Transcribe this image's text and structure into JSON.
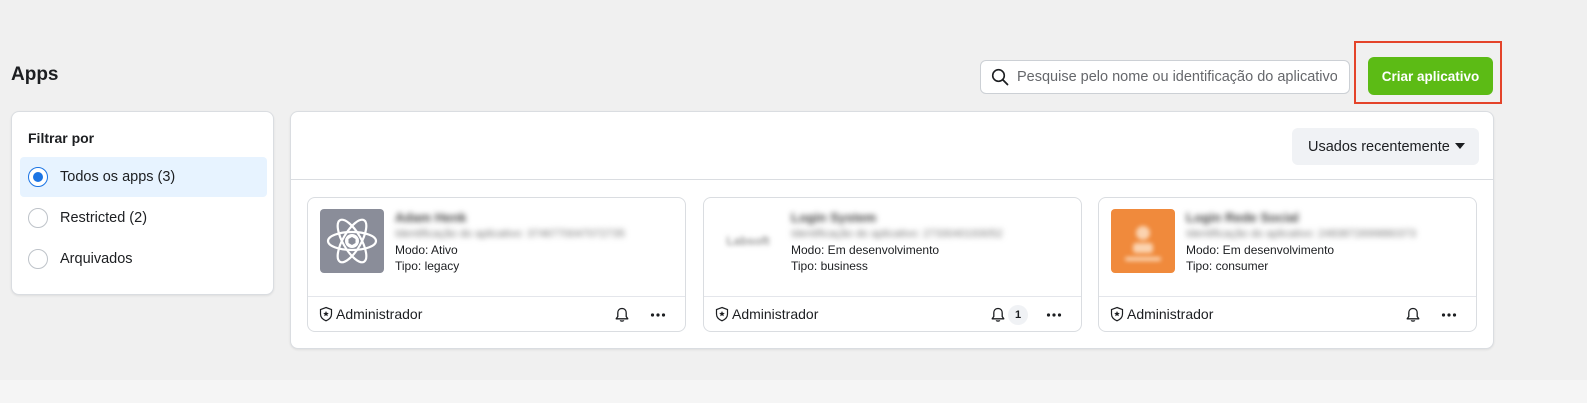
{
  "header": {
    "title": "Apps",
    "search_placeholder": "Pesquise pelo nome ou identificação do aplicativo",
    "search_icon": "search-icon",
    "create_button_label": "Criar aplicativo",
    "create_button_color": "#5cbb15",
    "highlight_color": "#e4442a"
  },
  "filter": {
    "title": "Filtrar por",
    "options": [
      {
        "label": "Todos os apps (3)",
        "selected": true
      },
      {
        "label": "Restricted (2)",
        "selected": false
      },
      {
        "label": "Arquivados",
        "selected": false
      }
    ]
  },
  "sort": {
    "label": "Usados recentemente",
    "icon": "caret-down-icon"
  },
  "apps": [
    {
      "name": "Adam Henk",
      "id_text": "Identificação do aplicativo: 3746770047072735",
      "mode": "Modo: Ativo",
      "type": "Tipo: legacy",
      "role": "Administrador",
      "thumb_style": "atom",
      "thumb_color": "#8a8d99",
      "notification_count": ""
    },
    {
      "name": "Login System",
      "id_text": "Identificação do aplicativo: 2733040193052",
      "mode": "Modo: Em desenvolvimento",
      "type": "Tipo: business",
      "role": "Administrador",
      "thumb_style": "logo",
      "thumb_text": "Labsoft",
      "notification_count": "1"
    },
    {
      "name": "Login Rede Social",
      "id_text": "Identificação do aplicativo: 2483872699880373",
      "mode": "Modo: Em desenvolvimento",
      "type": "Tipo: consumer",
      "role": "Administrador",
      "thumb_style": "orange",
      "thumb_color": "#f08a3c",
      "notification_count": ""
    }
  ]
}
